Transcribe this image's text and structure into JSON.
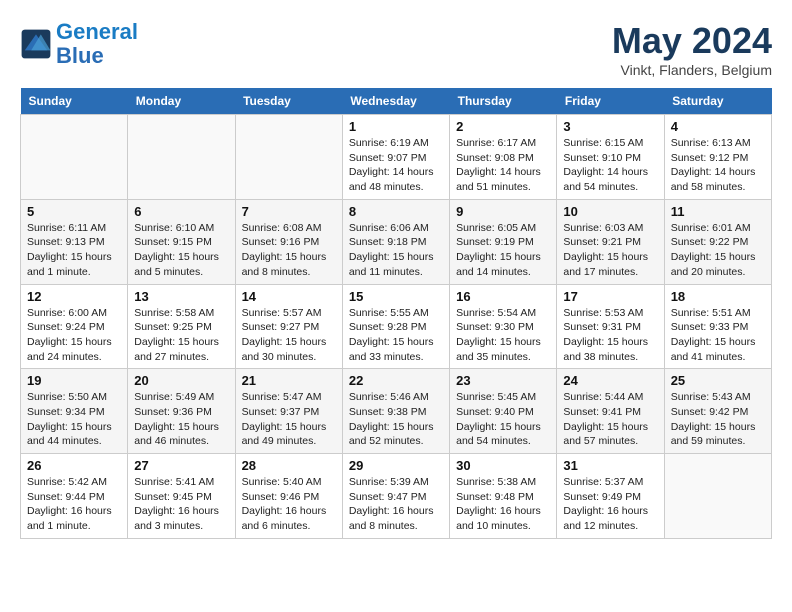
{
  "logo": {
    "line1": "General",
    "line2": "Blue"
  },
  "title": "May 2024",
  "subtitle": "Vinkt, Flanders, Belgium",
  "header_days": [
    "Sunday",
    "Monday",
    "Tuesday",
    "Wednesday",
    "Thursday",
    "Friday",
    "Saturday"
  ],
  "weeks": [
    [
      {
        "day": "",
        "info": ""
      },
      {
        "day": "",
        "info": ""
      },
      {
        "day": "",
        "info": ""
      },
      {
        "day": "1",
        "info": "Sunrise: 6:19 AM\nSunset: 9:07 PM\nDaylight: 14 hours\nand 48 minutes."
      },
      {
        "day": "2",
        "info": "Sunrise: 6:17 AM\nSunset: 9:08 PM\nDaylight: 14 hours\nand 51 minutes."
      },
      {
        "day": "3",
        "info": "Sunrise: 6:15 AM\nSunset: 9:10 PM\nDaylight: 14 hours\nand 54 minutes."
      },
      {
        "day": "4",
        "info": "Sunrise: 6:13 AM\nSunset: 9:12 PM\nDaylight: 14 hours\nand 58 minutes."
      }
    ],
    [
      {
        "day": "5",
        "info": "Sunrise: 6:11 AM\nSunset: 9:13 PM\nDaylight: 15 hours\nand 1 minute."
      },
      {
        "day": "6",
        "info": "Sunrise: 6:10 AM\nSunset: 9:15 PM\nDaylight: 15 hours\nand 5 minutes."
      },
      {
        "day": "7",
        "info": "Sunrise: 6:08 AM\nSunset: 9:16 PM\nDaylight: 15 hours\nand 8 minutes."
      },
      {
        "day": "8",
        "info": "Sunrise: 6:06 AM\nSunset: 9:18 PM\nDaylight: 15 hours\nand 11 minutes."
      },
      {
        "day": "9",
        "info": "Sunrise: 6:05 AM\nSunset: 9:19 PM\nDaylight: 15 hours\nand 14 minutes."
      },
      {
        "day": "10",
        "info": "Sunrise: 6:03 AM\nSunset: 9:21 PM\nDaylight: 15 hours\nand 17 minutes."
      },
      {
        "day": "11",
        "info": "Sunrise: 6:01 AM\nSunset: 9:22 PM\nDaylight: 15 hours\nand 20 minutes."
      }
    ],
    [
      {
        "day": "12",
        "info": "Sunrise: 6:00 AM\nSunset: 9:24 PM\nDaylight: 15 hours\nand 24 minutes."
      },
      {
        "day": "13",
        "info": "Sunrise: 5:58 AM\nSunset: 9:25 PM\nDaylight: 15 hours\nand 27 minutes."
      },
      {
        "day": "14",
        "info": "Sunrise: 5:57 AM\nSunset: 9:27 PM\nDaylight: 15 hours\nand 30 minutes."
      },
      {
        "day": "15",
        "info": "Sunrise: 5:55 AM\nSunset: 9:28 PM\nDaylight: 15 hours\nand 33 minutes."
      },
      {
        "day": "16",
        "info": "Sunrise: 5:54 AM\nSunset: 9:30 PM\nDaylight: 15 hours\nand 35 minutes."
      },
      {
        "day": "17",
        "info": "Sunrise: 5:53 AM\nSunset: 9:31 PM\nDaylight: 15 hours\nand 38 minutes."
      },
      {
        "day": "18",
        "info": "Sunrise: 5:51 AM\nSunset: 9:33 PM\nDaylight: 15 hours\nand 41 minutes."
      }
    ],
    [
      {
        "day": "19",
        "info": "Sunrise: 5:50 AM\nSunset: 9:34 PM\nDaylight: 15 hours\nand 44 minutes."
      },
      {
        "day": "20",
        "info": "Sunrise: 5:49 AM\nSunset: 9:36 PM\nDaylight: 15 hours\nand 46 minutes."
      },
      {
        "day": "21",
        "info": "Sunrise: 5:47 AM\nSunset: 9:37 PM\nDaylight: 15 hours\nand 49 minutes."
      },
      {
        "day": "22",
        "info": "Sunrise: 5:46 AM\nSunset: 9:38 PM\nDaylight: 15 hours\nand 52 minutes."
      },
      {
        "day": "23",
        "info": "Sunrise: 5:45 AM\nSunset: 9:40 PM\nDaylight: 15 hours\nand 54 minutes."
      },
      {
        "day": "24",
        "info": "Sunrise: 5:44 AM\nSunset: 9:41 PM\nDaylight: 15 hours\nand 57 minutes."
      },
      {
        "day": "25",
        "info": "Sunrise: 5:43 AM\nSunset: 9:42 PM\nDaylight: 15 hours\nand 59 minutes."
      }
    ],
    [
      {
        "day": "26",
        "info": "Sunrise: 5:42 AM\nSunset: 9:44 PM\nDaylight: 16 hours\nand 1 minute."
      },
      {
        "day": "27",
        "info": "Sunrise: 5:41 AM\nSunset: 9:45 PM\nDaylight: 16 hours\nand 3 minutes."
      },
      {
        "day": "28",
        "info": "Sunrise: 5:40 AM\nSunset: 9:46 PM\nDaylight: 16 hours\nand 6 minutes."
      },
      {
        "day": "29",
        "info": "Sunrise: 5:39 AM\nSunset: 9:47 PM\nDaylight: 16 hours\nand 8 minutes."
      },
      {
        "day": "30",
        "info": "Sunrise: 5:38 AM\nSunset: 9:48 PM\nDaylight: 16 hours\nand 10 minutes."
      },
      {
        "day": "31",
        "info": "Sunrise: 5:37 AM\nSunset: 9:49 PM\nDaylight: 16 hours\nand 12 minutes."
      },
      {
        "day": "",
        "info": ""
      }
    ]
  ]
}
